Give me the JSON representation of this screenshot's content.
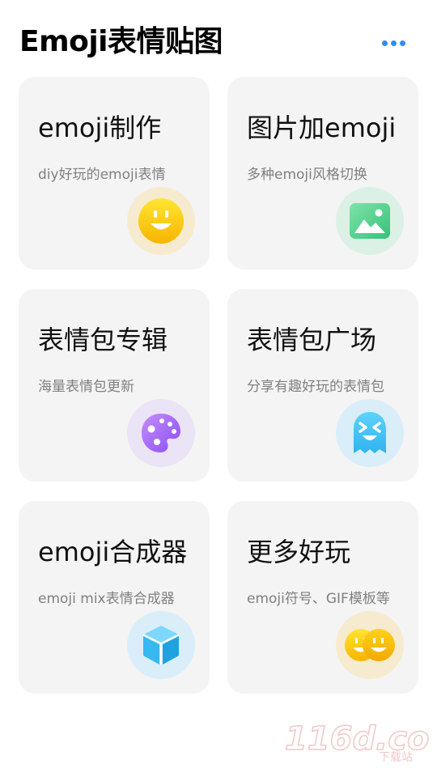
{
  "header": {
    "title": "Emoji表情贴图",
    "more_icon": "more-dots-icon",
    "accent_color": "#2e8ff0"
  },
  "cards": [
    {
      "title": "emoji制作",
      "subtitle": "diy好玩的emoji表情",
      "icon": "smiley-face-icon",
      "icon_bg": "#f7ebcf"
    },
    {
      "title": "图片加emoji",
      "subtitle": "多种emoji风格切换",
      "icon": "image-picture-icon",
      "icon_bg": "#dcf1e5"
    },
    {
      "title": "表情包专辑",
      "subtitle": "海量表情包更新",
      "icon": "palette-icon",
      "icon_bg": "#ebe4f7"
    },
    {
      "title": "表情包广场",
      "subtitle": "分享有趣好玩的表情包",
      "icon": "ghost-emoji-icon",
      "icon_bg": "#d9eef8"
    },
    {
      "title": "emoji合成器",
      "subtitle": "emoji mix表情合成器",
      "icon": "cube-icon",
      "icon_bg": "#d9eef8"
    },
    {
      "title": "更多好玩",
      "subtitle": "emoji符号、GIF模板等",
      "icon": "two-smileys-icon",
      "icon_bg": "#f7ebcf"
    }
  ],
  "watermark": {
    "text": "116d.com",
    "subtext": "下载站"
  }
}
